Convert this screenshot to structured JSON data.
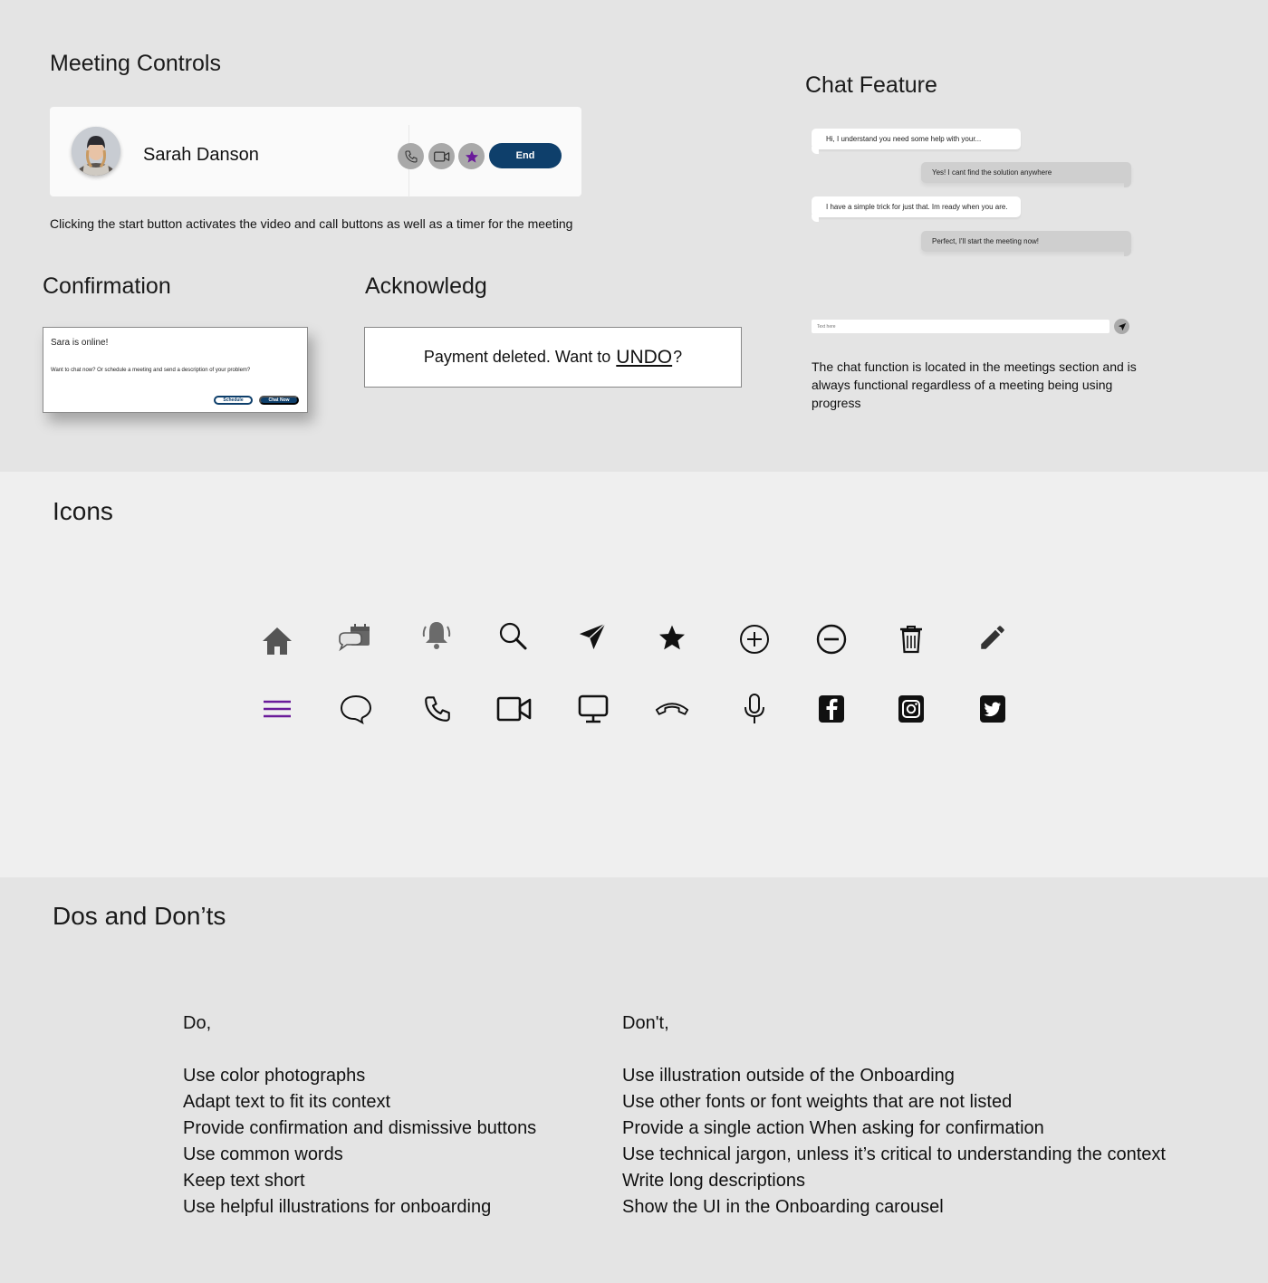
{
  "meeting": {
    "heading": "Meeting Controls",
    "name": "Sarah Danson",
    "end_label": "End",
    "caption": "Clicking the start button activates the video and call buttons as well as a timer for the meeting",
    "icons": [
      "phone-icon",
      "video-camera-icon",
      "star-icon"
    ],
    "accent_color": "#6a1b9a",
    "button_color": "#0e3f6b"
  },
  "confirmation": {
    "heading": "Confirmation",
    "title": "Sara is online!",
    "body": "Want to chat now? Or schedule a meeting and send a description of your problem?",
    "schedule_label": "Schedule",
    "chat_label": "Chat Now"
  },
  "acknowledg": {
    "heading": "Acknowledg",
    "text_before": "Payment deleted. Want to",
    "link": "UNDO",
    "text_after": "?"
  },
  "chat": {
    "heading": "Chat Feature",
    "messages": [
      {
        "from": "agent",
        "text": "Hi, I understand you need some help with your..."
      },
      {
        "from": "user",
        "text": "Yes! I cant find the solution anywhere"
      },
      {
        "from": "agent",
        "text": "I have a simple trick for just that. Im ready when you are."
      },
      {
        "from": "user",
        "text": "Perfect, I'll start the meeting now!"
      }
    ],
    "input_placeholder": "Text here",
    "caption": "The chat function is located in the meetings section and is always functional regardless of a meeting being using progress"
  },
  "icons_section": {
    "heading": "Icons",
    "row1": [
      "home-icon",
      "chat-calendar-icon",
      "notification-bell-icon",
      "search-icon",
      "send-icon",
      "star-icon",
      "plus-circle-icon",
      "minus-circle-icon",
      "trash-icon",
      "pencil-icon"
    ],
    "row2": [
      "menu-icon",
      "chat-bubble-icon",
      "phone-icon",
      "video-camera-icon",
      "monitor-icon",
      "hang-up-icon",
      "microphone-icon",
      "facebook-icon",
      "instagram-icon",
      "twitter-icon"
    ]
  },
  "dos_donts": {
    "heading": "Dos and Don’ts",
    "do_heading": "Do,",
    "do_items": [
      "Use color photographs",
      "Adapt text to fit its context",
      "Provide confirmation and dismissive buttons",
      "Use common words",
      "Keep text short",
      "Use helpful illustrations for onboarding"
    ],
    "dont_heading": "Don't,",
    "dont_items": [
      "Use illustration outside of the Onboarding",
      "Use other fonts or font weights that are not listed",
      "Provide a single action When asking for confirmation",
      "Use technical jargon, unless it’s critical to understanding the context",
      "Write long descriptions",
      "Show the UI in the Onboarding carousel"
    ]
  }
}
